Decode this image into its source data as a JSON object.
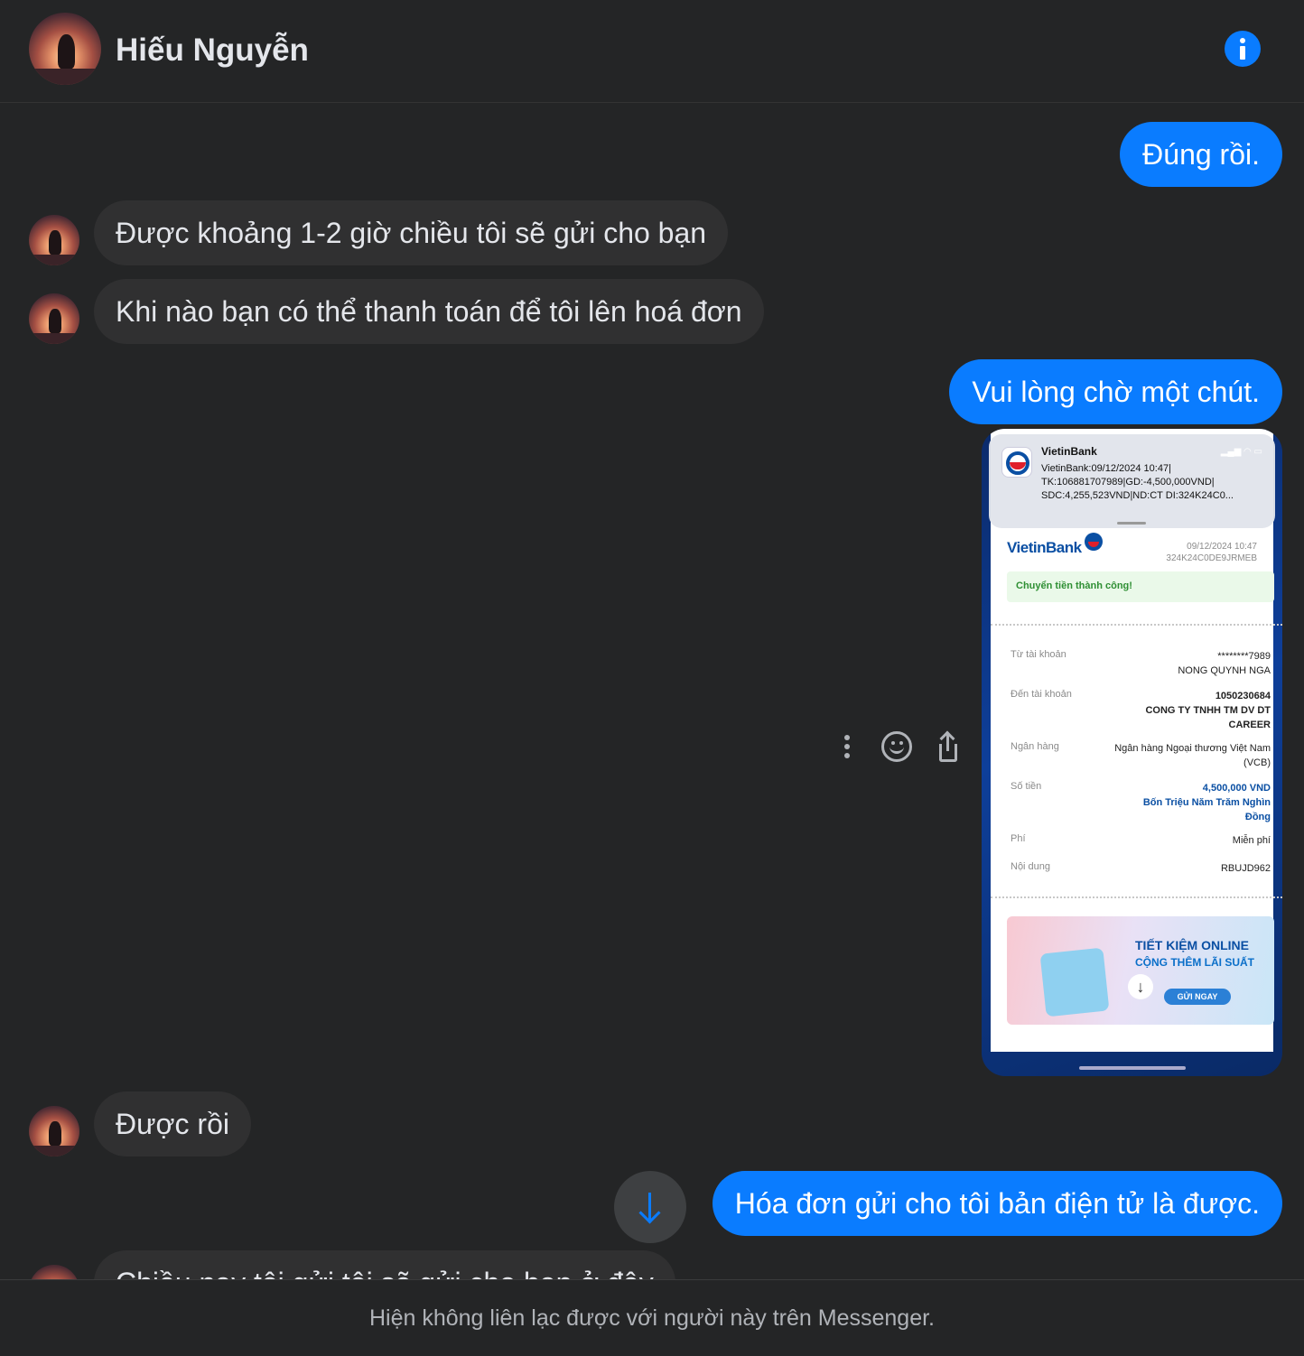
{
  "header": {
    "contact_name": "Hiếu Nguyễn",
    "info_icon": "info-icon"
  },
  "messages": [
    {
      "direction": "out",
      "text": "Đúng rồi."
    },
    {
      "direction": "in",
      "text": "Được khoảng 1-2 giờ chiều tôi sẽ gửi cho bạn"
    },
    {
      "direction": "in",
      "text": "Khi nào bạn có thể thanh toán để tôi lên hoá đơn"
    },
    {
      "direction": "out",
      "text": "Vui lòng chờ một chút."
    },
    {
      "direction": "out",
      "type": "image",
      "text": "receipt screenshot"
    },
    {
      "direction": "in",
      "text": "Được rồi"
    },
    {
      "direction": "out",
      "text": "Hóa đơn gửi cho tôi bản điện tử là được."
    },
    {
      "direction": "in",
      "text": "Chiều nay tôi gửi tôi sẽ gửi cho bạn ở đây"
    }
  ],
  "receipt": {
    "notif_app": "VietinBank",
    "notif_line1": "VietinBank:09/12/2024 10:47|",
    "notif_line2": "TK:106881707989|GD:-4,500,000VND|",
    "notif_line3": "SDC:4,255,523VND|ND:CT DI:324K24C0...",
    "brand": "VietinBank",
    "date": "09/12/2024 10:47",
    "ref": "324K24C0DE9JRMEB",
    "status": "Chuyển tiền thành công!",
    "rows": [
      {
        "label": "Từ tài khoản",
        "value": "********7989",
        "value2": "NONG QUYNH NGA"
      },
      {
        "label": "Đến tài khoản",
        "value": "1050230684",
        "value2": "CONG TY TNHH TM DV DT CAREER"
      },
      {
        "label": "Ngân hàng",
        "value": "Ngân hàng Ngoại thương Việt Nam (VCB)"
      },
      {
        "label": "Số tiền",
        "value": "4,500,000 VND",
        "value2": "Bốn Triệu Năm Trăm Nghìn Đồng"
      },
      {
        "label": "Phí",
        "value": "Miễn phí"
      },
      {
        "label": "Nội dung",
        "value": "RBUJD962"
      }
    ],
    "banner_title": "TIẾT KIỆM ONLINE",
    "banner_sub": "CỘNG THÊM LÃI SUẤT",
    "banner_btn": "GỬI NGAY"
  },
  "footer": {
    "notice": "Hiện không liên lạc được với người này trên Messenger."
  },
  "colors": {
    "outgoing_bubble": "#0a7cff",
    "incoming_bubble": "#303031",
    "background": "#242526"
  }
}
